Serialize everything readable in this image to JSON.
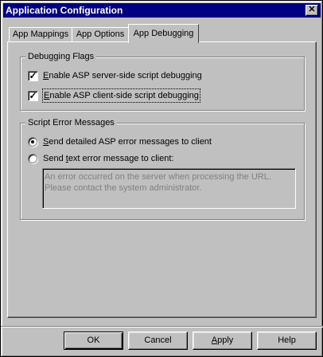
{
  "window": {
    "title": "Application Configuration",
    "close_glyph": "✕"
  },
  "tabs": [
    {
      "label": "App Mappings",
      "active": false
    },
    {
      "label": "App Options",
      "active": false
    },
    {
      "label": "App Debugging",
      "active": true
    }
  ],
  "debugging_flags": {
    "title": "Debugging Flags",
    "server_side": {
      "label_prefix": "E",
      "label_rest": "nable ASP server-side script debugging",
      "checked": true
    },
    "client_side": {
      "label_prefix": "E",
      "label_rest": "nable ASP client-side script debugging",
      "checked": true
    }
  },
  "script_errors": {
    "title": "Script Error Messages",
    "detailed": {
      "label_prefix": "S",
      "label_rest": "end detailed ASP error messages to client",
      "selected": true
    },
    "text": {
      "label_prefix": "Send ",
      "label_underlined": "t",
      "label_rest": "ext error message to client:",
      "selected": false
    },
    "message_text": "An error occurred on the server when processing the URL.  Please contact the system administrator."
  },
  "buttons": {
    "ok": "OK",
    "cancel": "Cancel",
    "apply_underlined": "A",
    "apply_rest": "pply",
    "help": "Help"
  },
  "check_glyph": "✓"
}
